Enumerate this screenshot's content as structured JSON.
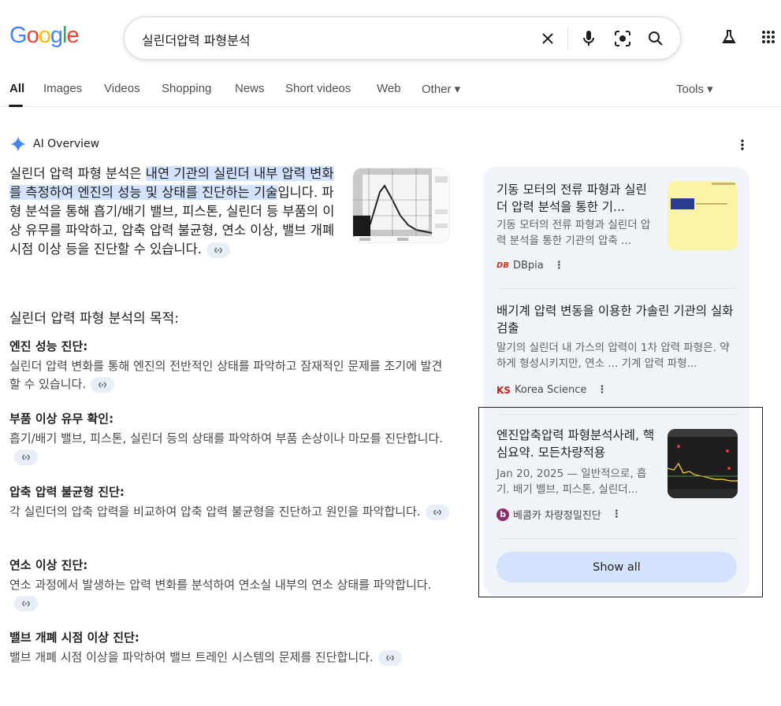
{
  "search": {
    "logo": "Google",
    "query": "실린더압력 파형분석"
  },
  "tabs": [
    {
      "label": "All"
    },
    {
      "label": "Images"
    },
    {
      "label": "Videos"
    },
    {
      "label": "Shopping"
    },
    {
      "label": "News"
    },
    {
      "label": "Short videos"
    },
    {
      "label": "Web"
    },
    {
      "label": "Other ▾"
    }
  ],
  "tools_label": "Tools ▾",
  "ai_overview": {
    "label": "AI Overview",
    "intro_plain": "실린더 압력 파형 분석은 ",
    "intro_highlight": "내연 기관의 실린더 내부 압력 변화를 측정하여 엔진의 성능 및 상태를 진단하는 기술",
    "intro_rest": "입니다. 파형 분석을 통해 흡기/배기 밸브, 피스톤, 실린더 등 부품의 이상 유무를 파악하고, 압축 압력 불균형, 연소 이상, 밸브 개폐 시점 이상 등을 진단할 수 있습니다.",
    "purpose_heading": "실린더 압력 파형 분석의 목적:",
    "sections": [
      {
        "title": "엔진 성능 진단:",
        "body": "실린더 압력 변화를 통해 엔진의 전반적인 상태를 파악하고 잠재적인 문제를 조기에 발견할 수 있습니다."
      },
      {
        "title": "부품 이상 유무 확인:",
        "body": "흡기/배기 밸브, 피스톤, 실린더 등의 상태를 파악하여 부품 손상이나 마모를 진단합니다."
      },
      {
        "title": "압축 압력 불균형 진단:",
        "body": "각 실린더의 압축 압력을 비교하여 압축 압력 불균형을 진단하고 원인을 파악합니다."
      },
      {
        "title": "연소 이상 진단:",
        "body": "연소 과정에서 발생하는 압력 변화를 분석하여 연소실 내부의 연소 상태를 파악합니다."
      },
      {
        "title": "밸브 개폐 시점 이상 진단:",
        "body": "밸브 개폐 시점 이상을 파악하여 밸브 트레인 시스템의 문제를 진단합니다."
      }
    ]
  },
  "sources": [
    {
      "title": "기동 모터의 전류 파형과 실린더 압력 분석을 통한 기...",
      "desc": "기동 모터의 전류 파형과 실린더 압력 분석을 통한 기관의 압축 ...",
      "source": "DBpia",
      "source_badge": "DB"
    },
    {
      "title": "배기계 압력 변동을 이용한 가솔린 기관의 실화 검출",
      "desc": "말기의 실린더 내 가스의 압력이 1차 압력 파형은. 약하게 형성시키지만, 연소 ... 기계 압력 파형...",
      "source": "Korea Science",
      "source_badge": "KS"
    },
    {
      "title": "엔진압축압력 파형분석사례, 핵심요약. 모든차량적용",
      "desc": "Jan 20, 2025 — 일반적으로, 흡기. 배기 밸브, 피스톤, 실린더...",
      "source": "베콤카 차량정밀진단",
      "source_badge": "b"
    }
  ],
  "show_all": "Show all",
  "colors": {
    "accent_blue": "#4285f4",
    "highlight": "#d3e3fd",
    "panel_bg": "#f0f4f9"
  }
}
